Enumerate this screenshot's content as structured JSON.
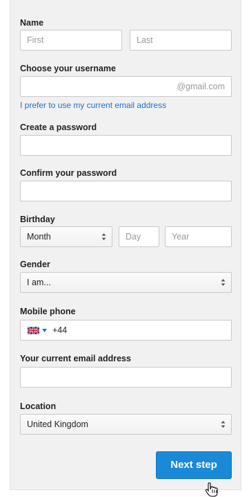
{
  "form": {
    "name": {
      "label": "Name",
      "first_placeholder": "First",
      "last_placeholder": "Last"
    },
    "username": {
      "label": "Choose your username",
      "suffix": "@gmail.com",
      "alt_link": "I prefer to use my current email address"
    },
    "password": {
      "label": "Create a password"
    },
    "confirm": {
      "label": "Confirm your password"
    },
    "birthday": {
      "label": "Birthday",
      "month": "Month",
      "day_placeholder": "Day",
      "year_placeholder": "Year"
    },
    "gender": {
      "label": "Gender",
      "value": "I am..."
    },
    "mobile": {
      "label": "Mobile phone",
      "prefix": "+44",
      "flag_icon": "uk-flag-icon"
    },
    "current_email": {
      "label": "Your current email address"
    },
    "location": {
      "label": "Location",
      "value": "United Kingdom"
    },
    "next_label": "Next step"
  },
  "colors": {
    "accent": "#1a8ad8",
    "link": "#1a73c9",
    "panel": "#f1f1f1"
  }
}
